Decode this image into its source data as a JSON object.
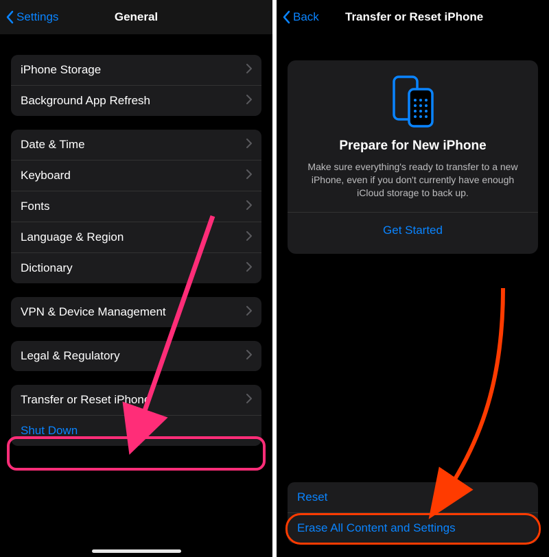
{
  "left": {
    "nav": {
      "back_label": "Settings",
      "title": "General"
    },
    "group1": [
      {
        "label": "iPhone Storage"
      },
      {
        "label": "Background App Refresh"
      }
    ],
    "group2": [
      {
        "label": "Date & Time"
      },
      {
        "label": "Keyboard"
      },
      {
        "label": "Fonts"
      },
      {
        "label": "Language & Region"
      },
      {
        "label": "Dictionary"
      }
    ],
    "group3": [
      {
        "label": "VPN & Device Management"
      }
    ],
    "group4": [
      {
        "label": "Legal & Regulatory"
      }
    ],
    "group5": [
      {
        "label": "Transfer or Reset iPhone",
        "chevron": true
      },
      {
        "label": "Shut Down",
        "chevron": false,
        "blue": true
      }
    ]
  },
  "right": {
    "nav": {
      "back_label": "Back",
      "title": "Transfer or Reset iPhone"
    },
    "card": {
      "title": "Prepare for New iPhone",
      "desc": "Make sure everything's ready to transfer to a new iPhone, even if you don't currently have enough iCloud storage to back up.",
      "action": "Get Started"
    },
    "bottom": [
      {
        "label": "Reset"
      },
      {
        "label": "Erase All Content and Settings"
      }
    ]
  },
  "annotations": {
    "left_arrow_color": "#ff2d78",
    "right_arrow_color": "#ff3b00"
  }
}
